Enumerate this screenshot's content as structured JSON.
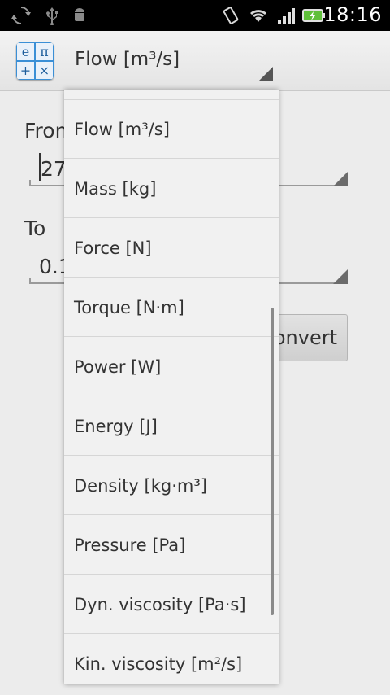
{
  "status_bar": {
    "time": "18:16",
    "icons": [
      "sync-icon",
      "usb-icon",
      "android-debug-icon",
      "vibrate-icon",
      "wifi-icon",
      "signal-icon",
      "battery-charging-icon"
    ]
  },
  "app_bar": {
    "logo_letters": [
      "e",
      "π",
      "+",
      "×"
    ],
    "selected_category": "Flow [m³/s]"
  },
  "form": {
    "from_label": "From",
    "from_value": "27",
    "to_label": "To",
    "to_value": "0.1",
    "convert_label": "Convert"
  },
  "dropdown": {
    "items": [
      "Flow [m³/s]",
      "Mass [kg]",
      "Force [N]",
      "Torque [N·m]",
      "Power [W]",
      "Energy [J]",
      "Density [kg·m³]",
      "Pressure [Pa]",
      "Dyn. viscosity [Pa·s]",
      "Kin. viscosity [m²/s]"
    ]
  },
  "colors": {
    "status_bar_bg": "#000000",
    "app_bar_bg": "#ececec",
    "logo_blue": "#3a8fd6",
    "text": "#333333"
  }
}
